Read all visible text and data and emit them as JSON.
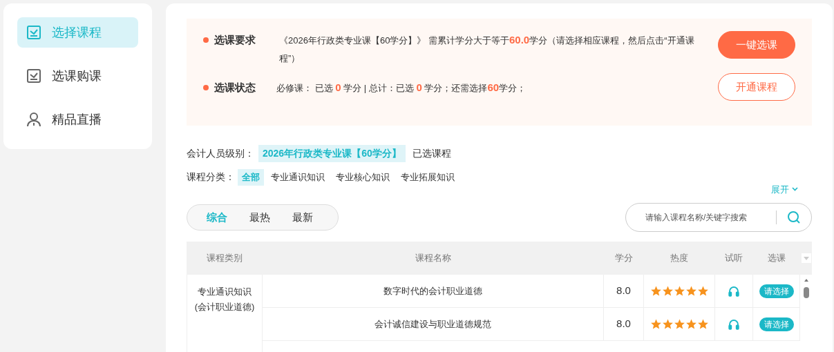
{
  "sidebar": {
    "items": [
      {
        "label": "选择课程",
        "kind": "check",
        "selected": true
      },
      {
        "label": "选课购课",
        "kind": "check",
        "selected": false
      },
      {
        "label": "精品直播",
        "kind": "person",
        "selected": false
      }
    ]
  },
  "notice": {
    "rows": [
      {
        "label": "选课要求",
        "text": "《2026年行政类专业课【60学分】》 需累计学分大于等于**60.0**学分（请选择相应课程，然后点击“开通课程”）",
        "button": "一键选课",
        "kind": "filled"
      },
      {
        "label": "选课状态",
        "text": "必修课：  已选 **0** 学分 | 总计：已选 **0** 学分；还需选择**60**学分；",
        "button": "开通课程",
        "kind": "outline"
      }
    ]
  },
  "level": {
    "label": "会计人员级别：",
    "value": "2026年行政类专业课【60学分】",
    "link": "已选课程"
  },
  "category": {
    "label": "课程分类：",
    "items": [
      {
        "label": "全部",
        "selected": true
      },
      {
        "label": "专业通识知识",
        "selected": false
      },
      {
        "label": "专业核心知识",
        "selected": false
      },
      {
        "label": "专业拓展知识",
        "selected": false
      }
    ],
    "expand": "展开"
  },
  "sort_tabs": [
    {
      "label": "综合",
      "selected": true
    },
    {
      "label": "最热",
      "selected": false
    },
    {
      "label": "最新",
      "selected": false
    }
  ],
  "search": {
    "placeholder": "请输入课程名称/关键字搜索"
  },
  "table": {
    "columns": [
      "课程类别",
      "课程名称",
      "学分",
      "热度",
      "试听",
      "选课"
    ],
    "group": "专业通识知识(会计职业道德)",
    "rows": [
      {
        "name": "数字时代的会计职业道德",
        "credit": "8.0",
        "stars": 5,
        "action": "请选择"
      },
      {
        "name": "会计诚信建设与职业道德规范",
        "credit": "8.0",
        "stars": 5,
        "action": "请选择"
      }
    ]
  }
}
